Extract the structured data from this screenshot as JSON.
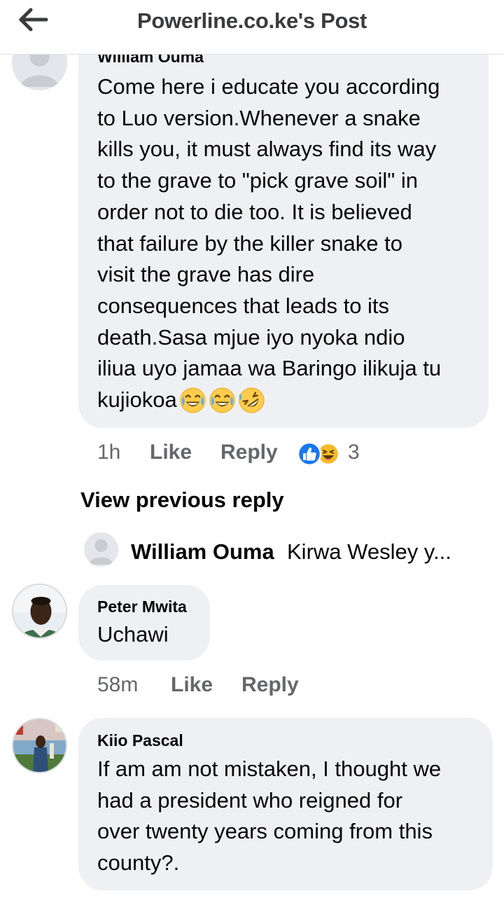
{
  "header": {
    "title": "Powerline.co.ke's Post",
    "back_icon": "arrow-left-icon"
  },
  "comments": [
    {
      "author": "William Ouma",
      "avatar": "default-avatar-icon",
      "lines": [
        "Come here i educate you according",
        "to Luo version.Whenever a snake",
        "kills you, it must always find its way",
        "to the grave to \"pick grave soil\" in",
        "order not to die too. It is believed",
        "that failure by the killer snake to",
        "visit the grave has dire",
        "consequences that leads to its",
        "death.Sasa mjue iyo nyoka ndio",
        "iliua uyo jamaa wa Baringo ilikuja tu",
        "kujiokoa"
      ],
      "trailing_emojis": [
        "tears-of-joy-emoji",
        "tears-of-joy-emoji",
        "rolling-laughing-emoji"
      ],
      "time": "1h",
      "like_label": "Like",
      "reply_label": "Reply",
      "reaction_icons": [
        "like-reaction-icon",
        "haha-reaction-icon"
      ],
      "reaction_count": "3"
    },
    {
      "author": "Peter Mwita",
      "avatar": "user-photo-avatar",
      "lines": [
        "Uchawi"
      ],
      "time": "58m",
      "like_label": "Like",
      "reply_label": "Reply"
    },
    {
      "author": "Kiio Pascal",
      "avatar": "user-photo-avatar",
      "lines": [
        "If am am not mistaken, I thought we",
        "had a president who reigned for",
        "over twenty years coming from this",
        "county?."
      ]
    }
  ],
  "view_previous_reply": "View previous reply",
  "reply_preview": {
    "author": "William Ouma",
    "snippet": "Kirwa Wesley y..."
  },
  "colors": {
    "bubble": "#eff0f3",
    "secondary_text": "#65676b",
    "like_blue": "#1877f2",
    "haha_yellow": "#f7b928"
  }
}
